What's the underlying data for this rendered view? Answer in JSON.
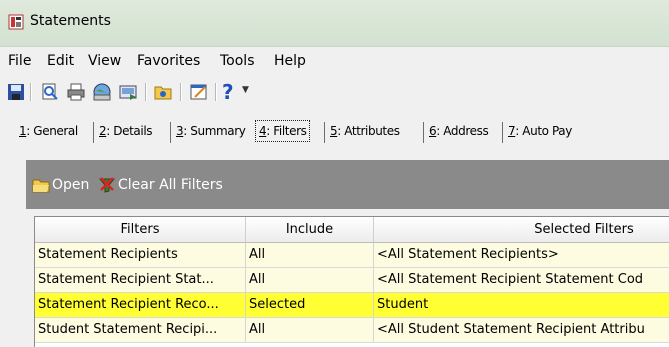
{
  "window": {
    "title": "Statements"
  },
  "menu": [
    "File",
    "Edit",
    "View",
    "Favorites",
    "Tools",
    "Help"
  ],
  "toolbar": {
    "help_label": "?"
  },
  "tabs": [
    {
      "key": "1",
      "label": ": General"
    },
    {
      "key": "2",
      "label": ": Details"
    },
    {
      "key": "3",
      "label": ": Summary"
    },
    {
      "key": "4",
      "label": ": Filters"
    },
    {
      "key": "5",
      "label": ": Attributes"
    },
    {
      "key": "6",
      "label": ": Address"
    },
    {
      "key": "7",
      "label": ": Auto Pay"
    }
  ],
  "panel": {
    "open_label": "Open",
    "clear_label": "Clear All Filters"
  },
  "grid": {
    "headers": [
      "Filters",
      "Include",
      "Selected Filters"
    ],
    "rows": [
      {
        "filter": "Statement Recipients",
        "include": "All",
        "selected": "<All Statement Recipients>"
      },
      {
        "filter": "Statement Recipient Stat...",
        "include": "All",
        "selected": "<All Statement Recipient Statement Cod"
      },
      {
        "filter": "Statement Recipient Reco...",
        "include": "Selected",
        "selected": "Student"
      },
      {
        "filter": "Student Statement Recipi...",
        "include": "All",
        "selected": "<All Student Statement Recipient Attribu"
      }
    ]
  },
  "colors": {
    "selected_row": "#ffff33",
    "normal_row": "#fdfbe0",
    "panel_bar": "#8a8a8a"
  }
}
